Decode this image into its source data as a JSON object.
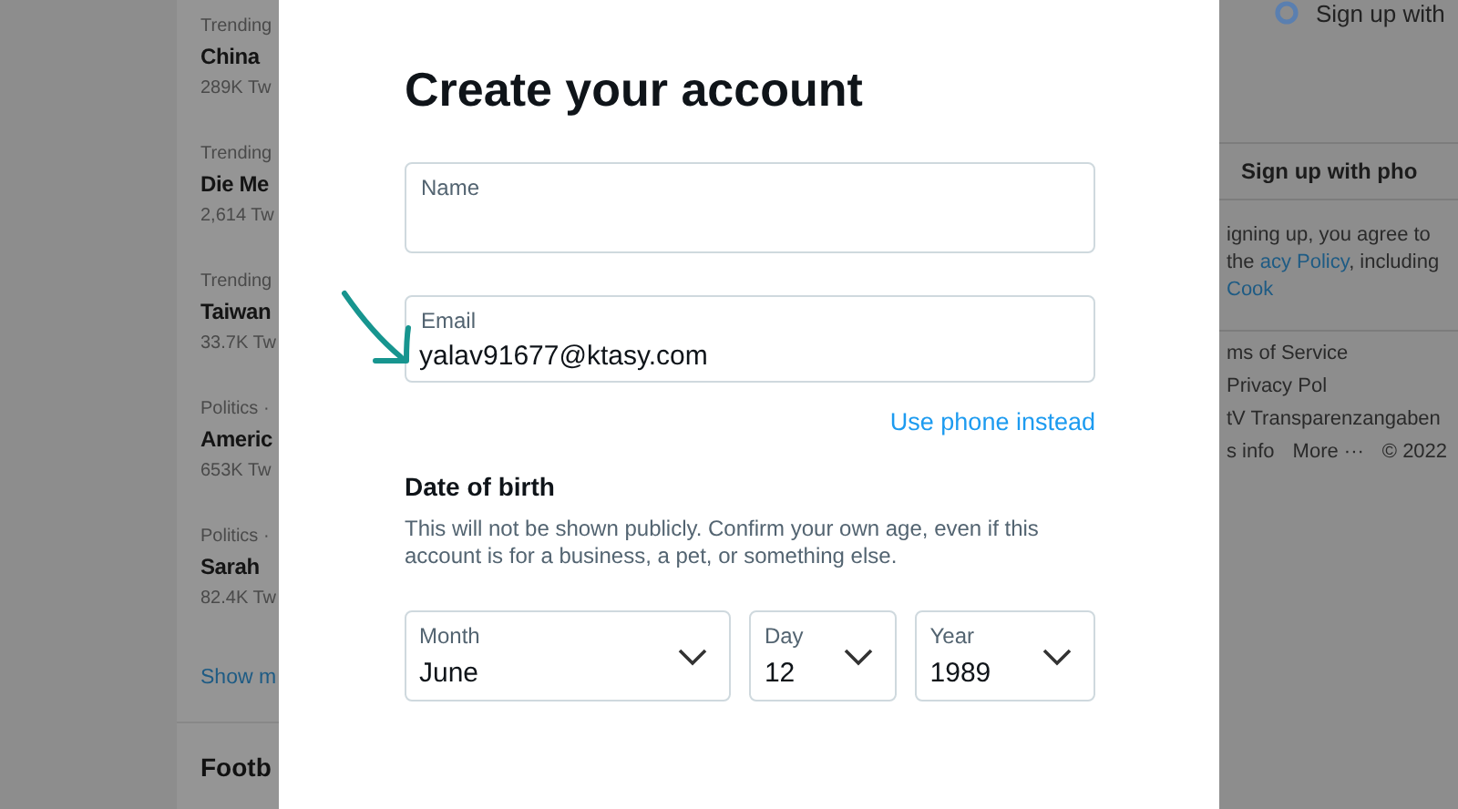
{
  "trends": [
    {
      "category": "Trending",
      "topic": "China",
      "count": "289K Tw"
    },
    {
      "category": "Trending",
      "topic": "Die Me",
      "count": "2,614 Tw"
    },
    {
      "category": "Trending",
      "topic": "Taiwan",
      "count": "33.7K Tw"
    },
    {
      "category": "Politics ·",
      "topic": "Americ",
      "count": "653K Tw"
    },
    {
      "category": "Politics ·",
      "topic": "Sarah",
      "count": "82.4K Tw"
    }
  ],
  "show_more": "Show m",
  "next_section": "Footb",
  "modal": {
    "title": "Create your account",
    "fields": [
      {
        "label": "Name"
      },
      {
        "label": "Email",
        "value": "yalav91677@ktasy.com"
      }
    ],
    "alternate_link": "Use phone instead",
    "date_of_birth": {
      "heading": "Date of birth",
      "description": "This will not be shown publicly. Confirm your own age, even if this account is for a business, a pet, or something else."
    },
    "selects": [
      {
        "label": "Month",
        "value": "June"
      },
      {
        "label": "Day",
        "value": "12"
      },
      {
        "label": "Year",
        "value": "1989"
      }
    ]
  },
  "sidebar": {
    "google_button": "Sign up with",
    "phone_button": "Sign up with pho",
    "terms": {
      "line_1": "igning up, you agree to the",
      "link_1": "acy Policy",
      "middle": ", including",
      "link_2": "Cook"
    },
    "footer_links": [
      [
        "ms of Service",
        "Privacy Pol"
      ],
      [
        "tV Transparenzangaben"
      ],
      [
        "s info",
        "More ···",
        "© 2022"
      ]
    ]
  }
}
